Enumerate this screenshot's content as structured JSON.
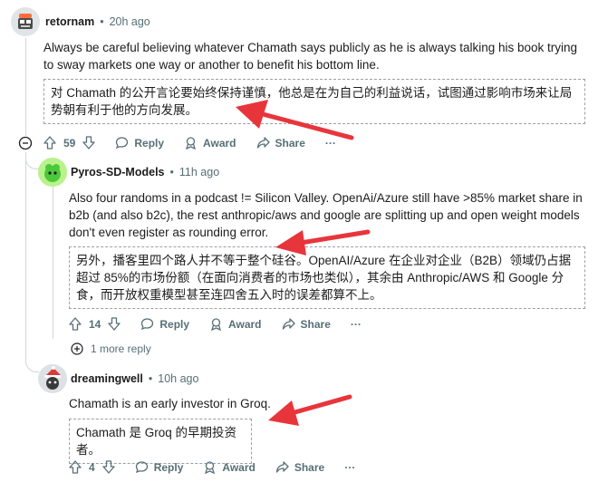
{
  "colors": {
    "accent_red": "#e8353c",
    "meta_gray": "#576f76",
    "thread_line": "#d0d7da"
  },
  "comments": [
    {
      "username": "retornam",
      "separator": "•",
      "time": "20h ago",
      "avatar_icon": "retro-avatar-icon",
      "body": "Always be careful believing whatever Chamath says publicly as he is always talking his book trying to sway markets one way or another to benefit his bottom line.",
      "translation": "对 Chamath 的公开言论要始终保持谨慎，他总是在为自己的利益说话，试图通过影响市场来让局势朝有利于他的方向发展。",
      "votes": "59",
      "actions": {
        "reply": "Reply",
        "award": "Award",
        "share": "Share",
        "more": "···"
      }
    },
    {
      "username": "Pyros-SD-Models",
      "separator": "•",
      "time": "11h ago",
      "avatar_icon": "green-blob-avatar-icon",
      "body": "Also four randoms in a podcast != Silicon Valley. OpenAi/Azure still have >85% market share in b2b (and also b2c), the rest anthropic/aws and google are splitting up and open weight models don't even register as rounding error.",
      "translation": "另外，播客里四个路人并不等于整个硅谷。OpenAI/Azure 在企业对企业（B2B）领域仍占据超过 85%的市场份额（在面向消费者的市场也类似），其余由 Anthropic/AWS 和 Google 分食，而开放权重模型甚至连四舍五入时的误差都算不上。",
      "votes": "14",
      "actions": {
        "reply": "Reply",
        "award": "Award",
        "share": "Share",
        "more": "···"
      },
      "more_replies": "1 more reply"
    },
    {
      "username": "dreamingwell",
      "separator": "•",
      "time": "10h ago",
      "avatar_icon": "santa-avatar-icon",
      "body": "Chamath is an early investor in Groq.",
      "translation": "Chamath 是 Groq 的早期投资者。",
      "votes": "4",
      "actions": {
        "reply": "Reply",
        "award": "Award",
        "share": "Share",
        "more": "···"
      }
    }
  ]
}
